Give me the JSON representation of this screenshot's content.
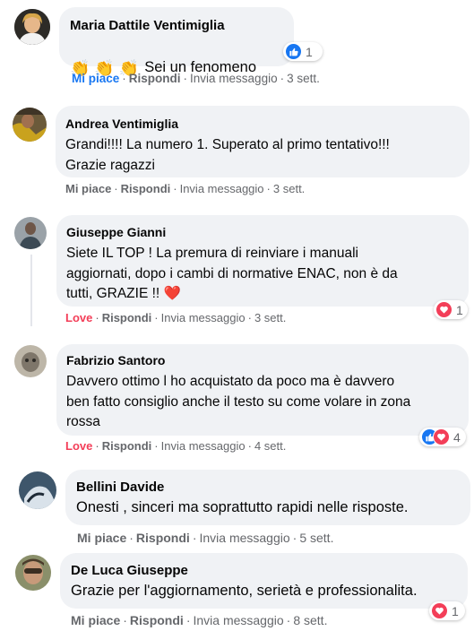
{
  "comments": [
    {
      "author": "Maria Dattile Ventimiglia",
      "prefix_emoji": "👏 👏 👏",
      "text": "Sei un fenomeno",
      "actions": [
        "Mi piace",
        "Rispondi",
        "Invia messaggio",
        "3 sett."
      ],
      "reaction_count": "1",
      "reaction_types": [
        "like"
      ]
    },
    {
      "author": "Andrea Ventimiglia",
      "text": "Grandi!!!! La numero 1. Superato al primo tentativo!!!\nGrazie ragazzi",
      "actions": [
        "Mi piace",
        "Rispondi",
        "Invia messaggio",
        "3 sett."
      ]
    },
    {
      "author": "Giuseppe Gianni",
      "text": "Siete IL TOP ! La premura di reinviare i manuali\naggiornati, dopo i cambi di normative ENAC, non è da\ntutti, GRAZIE !!",
      "heart": "❤️",
      "actions": [
        "Love",
        "Rispondi",
        "Invia messaggio",
        "3 sett."
      ],
      "reaction_count": "1",
      "reaction_types": [
        "love"
      ]
    },
    {
      "author": "Fabrizio Santoro",
      "text": "Davvero ottimo l ho acquistato da poco ma è davvero\nben fatto consiglio anche il testo su come volare in zona\nrossa",
      "actions": [
        "Love",
        "Rispondi",
        "Invia messaggio",
        "4 sett."
      ],
      "reaction_count": "4",
      "reaction_types": [
        "like",
        "love"
      ]
    },
    {
      "author": "Bellini Davide",
      "text": "Onesti , sinceri ma soprattutto rapidi nelle risposte.",
      "actions": [
        "Mi piace",
        "Rispondi",
        "Invia messaggio",
        "5 sett."
      ]
    },
    {
      "author": "De Luca Giuseppe",
      "text": "Grazie per l'aggiornamento, serietà e professionalita.",
      "actions": [
        "Mi piace",
        "Rispondi",
        "Invia messaggio",
        "8 sett."
      ],
      "reaction_count": "1",
      "reaction_types": [
        "love"
      ]
    }
  ],
  "colors": {
    "like": "#1877f2",
    "love": "#f33e58",
    "bubble": "#f0f2f5",
    "meta": "#65676b"
  }
}
